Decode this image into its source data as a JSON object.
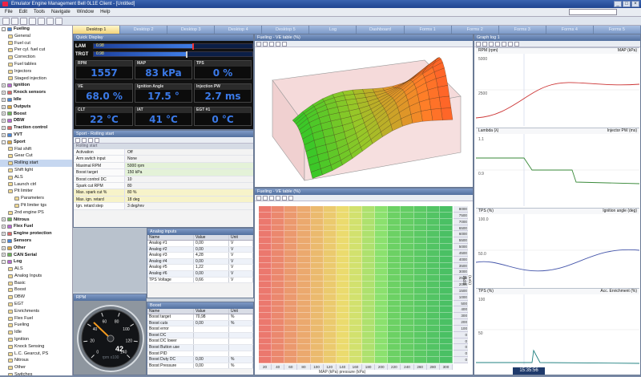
{
  "window": {
    "title": "Emulator Engine Management Bell 0L1E Client - [Untitled]"
  },
  "menu": [
    "File",
    "Edit",
    "Tools",
    "Navigate",
    "Window",
    "Help"
  ],
  "tabs": [
    "Desktop 1",
    "Desktop 2",
    "Desktop 3",
    "Desktop 4",
    "Desktop 5",
    "Log",
    "Dashboard",
    "Forms 1",
    "Forms 2",
    "Forms 3",
    "Forms 4",
    "Forms 5"
  ],
  "active_tab": 0,
  "tree": [
    {
      "label": "Fueling",
      "level": 0,
      "bold": true,
      "exp": "-"
    },
    {
      "label": "General",
      "level": 1
    },
    {
      "label": "Fuel cut",
      "level": 1
    },
    {
      "label": "Per cyl. fuel cut",
      "level": 1
    },
    {
      "label": "Correction",
      "level": 1
    },
    {
      "label": "Fuel tables",
      "level": 1
    },
    {
      "label": "Injectors",
      "level": 1
    },
    {
      "label": "Staged injection",
      "level": 1
    },
    {
      "label": "Ignition",
      "level": 0,
      "bold": true,
      "exp": "+"
    },
    {
      "label": "Knock sensors",
      "level": 0,
      "bold": true,
      "exp": "+"
    },
    {
      "label": "Idle",
      "level": 0,
      "bold": true,
      "exp": "+"
    },
    {
      "label": "Outputs",
      "level": 0,
      "bold": true,
      "exp": "+"
    },
    {
      "label": "Boost",
      "level": 0,
      "bold": true,
      "exp": "+"
    },
    {
      "label": "DBW",
      "level": 0,
      "bold": true,
      "exp": "+"
    },
    {
      "label": "Traction control",
      "level": 0,
      "bold": true,
      "exp": "+"
    },
    {
      "label": "VVT",
      "level": 0,
      "bold": true,
      "exp": "+"
    },
    {
      "label": "Sport",
      "level": 0,
      "bold": true,
      "exp": "-"
    },
    {
      "label": "Flat shift",
      "level": 1
    },
    {
      "label": "Gear Cut",
      "level": 1
    },
    {
      "label": "Rolling start",
      "level": 1,
      "selected": true
    },
    {
      "label": "Shift light",
      "level": 1
    },
    {
      "label": "ALS",
      "level": 1
    },
    {
      "label": "Launch ctrl",
      "level": 1
    },
    {
      "label": "Pit limiter",
      "level": 1
    },
    {
      "label": "Parameters",
      "level": 2
    },
    {
      "label": "Pit limiter tgs",
      "level": 2
    },
    {
      "label": "2nd engine PS",
      "level": 1
    },
    {
      "label": "Nitrous",
      "level": 0,
      "bold": true,
      "exp": "+"
    },
    {
      "label": "Flex Fuel",
      "level": 0,
      "bold": true,
      "exp": "+"
    },
    {
      "label": "Engine protection",
      "level": 0,
      "bold": true,
      "exp": "+"
    },
    {
      "label": "Sensors",
      "level": 0,
      "bold": true,
      "exp": "+"
    },
    {
      "label": "Other",
      "level": 0,
      "bold": true,
      "exp": "+"
    },
    {
      "label": "CAN Serial",
      "level": 0,
      "bold": true,
      "exp": "+"
    },
    {
      "label": "Log",
      "level": 0,
      "bold": true,
      "exp": "-"
    },
    {
      "label": "ALS",
      "level": 1
    },
    {
      "label": "Analog Inputs",
      "level": 1
    },
    {
      "label": "Basic",
      "level": 1
    },
    {
      "label": "Boost",
      "level": 1
    },
    {
      "label": "DBW",
      "level": 1
    },
    {
      "label": "EGT",
      "level": 1
    },
    {
      "label": "Enrichments",
      "level": 1
    },
    {
      "label": "Flex Fuel",
      "level": 1
    },
    {
      "label": "Fueling",
      "level": 1
    },
    {
      "label": "Idle",
      "level": 1
    },
    {
      "label": "Ignition",
      "level": 1
    },
    {
      "label": "Knock Sensing",
      "level": 1
    },
    {
      "label": "L.C. Gearcut, PS",
      "level": 1
    },
    {
      "label": "Nitrous",
      "level": 1
    },
    {
      "label": "Other",
      "level": 1
    },
    {
      "label": "Switches",
      "level": 1
    }
  ],
  "gauges": {
    "title": "Quick Display",
    "lam": {
      "label": "LAM",
      "value": "0.98",
      "fill": 0.62
    },
    "trgt": {
      "label": "TRGT",
      "value": "0.98",
      "fill": 0.58
    },
    "cells": [
      {
        "cap": "RPM",
        "val": "1557"
      },
      {
        "cap": "MAP",
        "val": "83 kPa"
      },
      {
        "cap": "TPS",
        "val": "0 %"
      },
      {
        "cap": "VE",
        "val": "68.0 %"
      },
      {
        "cap": "Ignition Angle",
        "val": "17.5 °"
      },
      {
        "cap": "Injection PW",
        "val": "2.7 ms"
      },
      {
        "cap": "CLT",
        "val": "22 °C"
      },
      {
        "cap": "IAT",
        "val": "41 °C"
      },
      {
        "cap": "EGT #1",
        "val": "0 °C"
      }
    ]
  },
  "spark": {
    "title": "Sport - Rolling start",
    "sub": "Rolling start",
    "rows": [
      {
        "k": "Activation",
        "v": "Off"
      },
      {
        "k": "Arm switch input",
        "v": "None"
      },
      {
        "k": "Maximal RPM",
        "v": "5000 rpm",
        "cls": "gr"
      },
      {
        "k": "Boost target",
        "v": "150 kPa",
        "cls": "gr"
      },
      {
        "k": "Boost control DC",
        "v": "10"
      },
      {
        "k": "Spark cut RPM",
        "v": "80"
      },
      {
        "k": "Max. spark cut %",
        "v": "80 %",
        "cls": "hl"
      },
      {
        "k": "Max. ign. retard",
        "v": "18 deg",
        "cls": "hl"
      },
      {
        "k": "Ign. retard step",
        "v": "3 deg/rev"
      }
    ]
  },
  "analog_table": {
    "title": "Analog inputs",
    "cols": [
      "Name",
      "Value",
      "Unit"
    ],
    "rows": [
      [
        "Analog #1",
        "0,00",
        "V"
      ],
      [
        "Analog #2",
        "0,00",
        "V"
      ],
      [
        "Analog #3",
        "4,28",
        "V"
      ],
      [
        "Analog #4",
        "0,00",
        "V"
      ],
      [
        "Analog #5",
        "1,22",
        "V"
      ],
      [
        "Analog #6",
        "0,00",
        "V"
      ],
      [
        "TPS Voltage",
        "0,66",
        "V"
      ]
    ]
  },
  "boost_table": {
    "title": "Boost",
    "cols": [
      "Name",
      "Value",
      "Unit"
    ],
    "rows": [
      [
        "Boost target",
        "70,98",
        "%"
      ],
      [
        "Boost cuts",
        "0,00",
        "%"
      ],
      [
        "Boost error",
        "",
        ""
      ],
      [
        "Boost DC",
        "",
        ""
      ],
      [
        "Boost DC lower",
        "",
        ""
      ],
      [
        "Boost Button use",
        "",
        ""
      ],
      [
        "Boost PID",
        "",
        ""
      ],
      [
        "Boost Duty DC",
        "0,00",
        "%"
      ],
      [
        "Boost Pressure",
        "0,00",
        "%"
      ]
    ]
  },
  "rpm_gauge": {
    "title": "RPM",
    "value": "42",
    "ticks": [
      "0",
      "20",
      "40",
      "60",
      "80",
      "100",
      "120",
      "140"
    ],
    "unit": "rpm x100"
  },
  "surface": {
    "title": "Fueling - VE table (%)"
  },
  "fuel_table": {
    "title": "Fueling - VE table (%)",
    "xlabel": "MAP (kPa) pressure (kPa)",
    "ylabel": "RPM (rpm)",
    "rows": [
      "8000",
      "7500",
      "7000",
      "6500",
      "6000",
      "5500",
      "5000",
      "4500",
      "4000",
      "3500",
      "3000",
      "2500",
      "2000",
      "1500",
      "1000",
      "500",
      "400",
      "300",
      "200",
      "100",
      "0",
      "0",
      "0",
      "0",
      "0"
    ],
    "cols": [
      "20",
      "40",
      "60",
      "80",
      "100",
      "120",
      "140",
      "160",
      "180",
      "200",
      "220",
      "240",
      "260",
      "280",
      "300"
    ]
  },
  "log": {
    "title": "Graph log 1",
    "sections": [
      {
        "left": "RPM (rpm)",
        "right": "MAP (kPa)",
        "l0": "5000",
        "l1": "2500"
      },
      {
        "left": "Lambda (λ)",
        "right": "Injector PW (ms)",
        "l0": "1.1",
        "l1": "0.9"
      },
      {
        "left": "TPS (%)",
        "right": "Ignition angle (deg)",
        "l0": "100.0",
        "l1": "50.0"
      },
      {
        "left": "TPS (%)",
        "right": "Acc. Enrichment (%)",
        "l0": "100",
        "l1": "50"
      }
    ],
    "time": "15:35:56"
  },
  "colors": {
    "accent": "#f3d37a",
    "panel_header": "#52709f",
    "gauge_blue": "#3b7ae8"
  }
}
